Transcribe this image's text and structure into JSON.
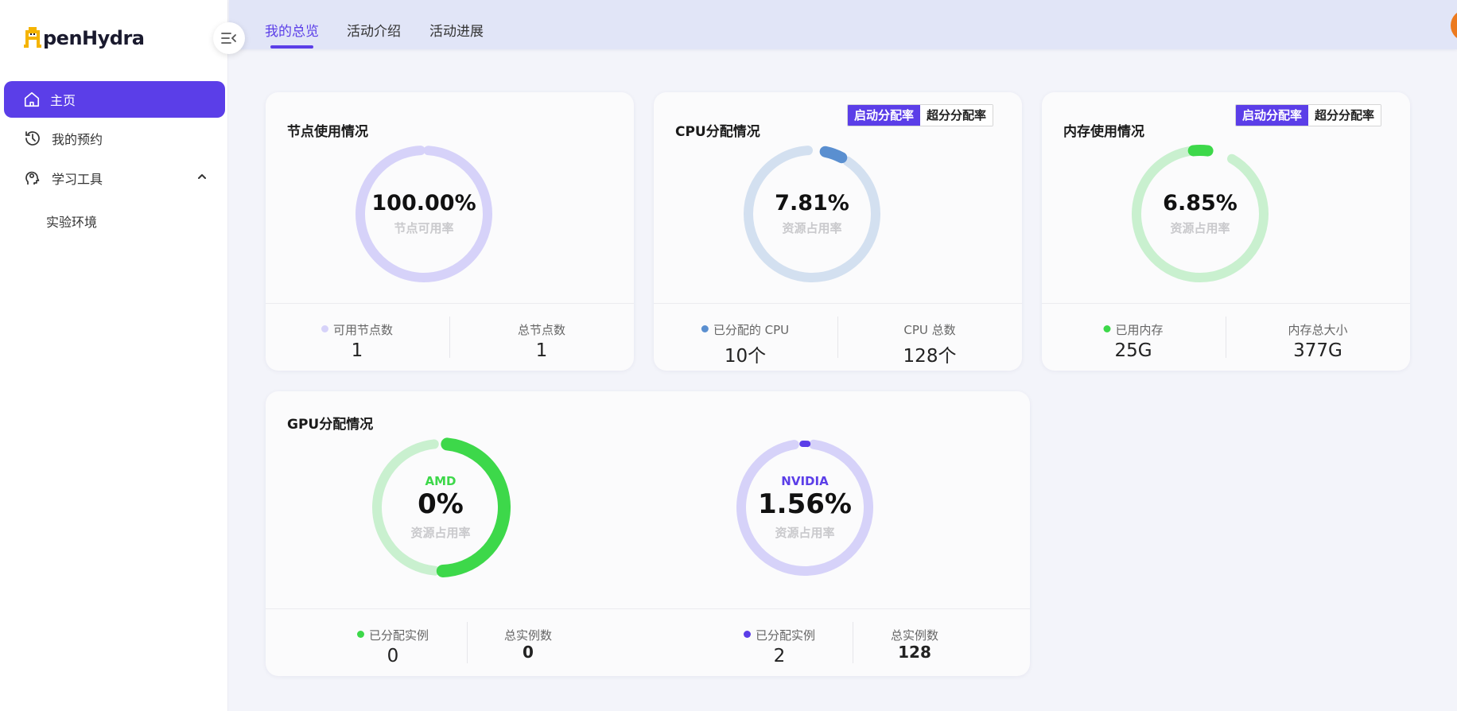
{
  "brand": {
    "logo_text": "penHydra"
  },
  "sidebar": {
    "items": [
      {
        "label": "主页"
      },
      {
        "label": "我的预约"
      },
      {
        "label": "学习工具"
      }
    ],
    "sub_items": [
      {
        "label": "实验环境"
      }
    ]
  },
  "topbar": {
    "tabs": [
      {
        "label": "我的总览"
      },
      {
        "label": "活动介绍"
      },
      {
        "label": "活动进展"
      }
    ]
  },
  "toggle": {
    "on_label": "启动分配率",
    "off_label": "超分分配率"
  },
  "colors": {
    "accent": "#5b3ee8",
    "node_track": "#d6d2f9",
    "cpu_track": "#d3e0f0",
    "cpu_fill": "#5a8fd0",
    "mem_track": "#c9f0cf",
    "mem_fill": "#3dd84a",
    "amd_fill": "#3dd84a",
    "nvidia_fill": "#5b3ee8"
  },
  "cards": {
    "node": {
      "title": "节点使用情况",
      "gauge_value": "100.00%",
      "gauge_sub": "节点可用率",
      "stats": [
        {
          "label": "可用节点数",
          "value": "1"
        },
        {
          "label": "总节点数",
          "value": "1"
        }
      ]
    },
    "cpu": {
      "title": "CPU分配情况",
      "gauge_value": "7.81%",
      "gauge_sub": "资源占用率",
      "stats": [
        {
          "label": "已分配的 CPU",
          "value": "10个"
        },
        {
          "label": "CPU 总数",
          "value": "128个"
        }
      ]
    },
    "memory": {
      "title": "内存使用情况",
      "gauge_value": "6.85%",
      "gauge_sub": "资源占用率",
      "stats": [
        {
          "label": "已用内存",
          "value": "25G"
        },
        {
          "label": "内存总大小",
          "value": "377G"
        }
      ]
    },
    "gpu": {
      "title": "GPU分配情况",
      "amd": {
        "brand": "AMD",
        "gauge_value": "0%",
        "gauge_sub": "资源占用率",
        "stats": [
          {
            "label": "已分配实例",
            "value": "0"
          },
          {
            "label": "总实例数",
            "value": "0"
          }
        ]
      },
      "nvidia": {
        "brand": "NVIDIA",
        "gauge_value": "1.56%",
        "gauge_sub": "资源占用率",
        "stats": [
          {
            "label": "已分配实例",
            "value": "2"
          },
          {
            "label": "总实例数",
            "value": "128"
          }
        ]
      }
    }
  }
}
